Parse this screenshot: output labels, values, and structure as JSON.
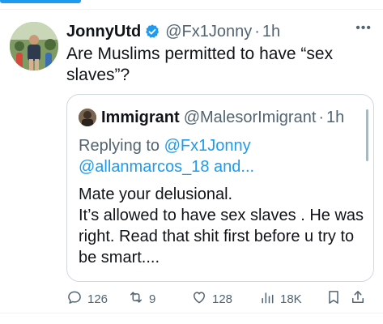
{
  "tweet": {
    "author_name": "JonnyUtd",
    "author_handle": "@Fx1Jonny",
    "separator": "·",
    "time": "1h",
    "text": "Are Muslims permitted to have “sex slaves”?"
  },
  "quote": {
    "author_name": "Immigrant",
    "author_handle": "@MalesorImigrant",
    "separator": "·",
    "time": "1h",
    "replying_prefix": "Replying to ",
    "replying_to": [
      "@Fx1Jonny",
      "@allanmarcos_18"
    ],
    "replying_suffix": " and...",
    "lines": [
      "Mate your delusional.",
      "It’s allowed to have sex slaves . He was right. Read that shit first before u try to be smart...."
    ]
  },
  "actions": {
    "replies": "126",
    "reposts": "9",
    "likes": "128",
    "views": "18K"
  },
  "icons": [
    "verified-badge-icon",
    "more-icon",
    "reply-icon",
    "repost-icon",
    "like-icon",
    "views-icon",
    "bookmark-icon",
    "share-icon"
  ],
  "colors": {
    "accent": "#1d9bf0",
    "text": "#0f1419",
    "muted": "#536471",
    "border": "#cfd9de"
  }
}
